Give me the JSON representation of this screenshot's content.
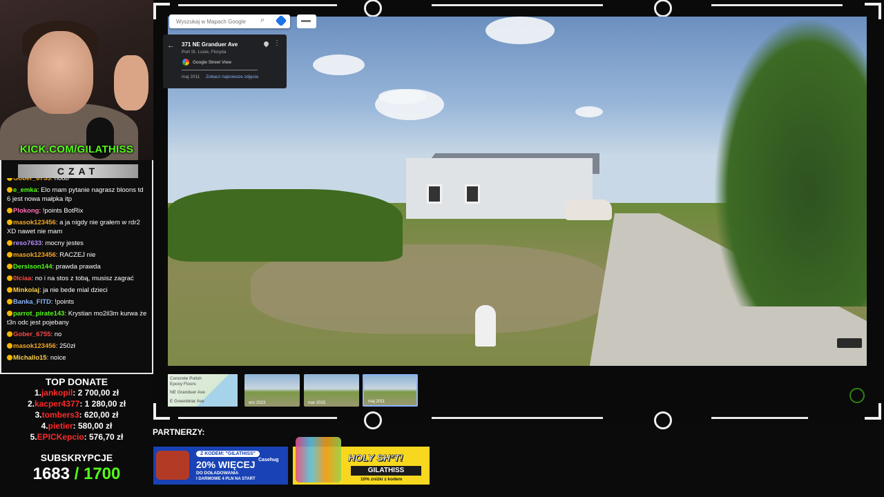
{
  "stream": {
    "kick_url": "KICK.COM/GILATHISS",
    "chat_title": "CZAT",
    "chat_messages": [
      {
        "user": "Gober_6755",
        "text": "noob",
        "color": "#f5a623"
      },
      {
        "user": "e_emka",
        "text": "Elo mam pytanie nagrasz bloons td 6 jest nowa małpka itp",
        "color": "#53fc18"
      },
      {
        "user": "Plokong",
        "text": "!points BotRix",
        "color": "#ff6fb5"
      },
      {
        "user": "masok123456",
        "text": "a ja nigdy nie grałem w rdr2 XD nawet nie mam",
        "color": "#f5a623"
      },
      {
        "user": "reso7633",
        "text": "mocny jestes",
        "color": "#b48cff"
      },
      {
        "user": "masok123456",
        "text": "RACZEJ nie",
        "color": "#f5a623"
      },
      {
        "user": "Dersison144",
        "text": "prawda prawda",
        "color": "#53fc18"
      },
      {
        "user": "0lciaa",
        "text": "no i na stos z tobą, musisz zagrać",
        "color": "#ff4646"
      },
      {
        "user": "Minkolaj",
        "text": "ja nie bede mial dzieci",
        "color": "#ffd24a"
      },
      {
        "user": "Banka_FITD",
        "text": "!points",
        "color": "#8ab4f8"
      },
      {
        "user": "parrot_pirate143",
        "text": "Krystian mo2il3m kurwa że t3n odc jest pojebany",
        "color": "#53fc18"
      },
      {
        "user": "Gober_6755",
        "text": "no",
        "color": "#ff4646"
      },
      {
        "user": "masok123456",
        "text": "250zł",
        "color": "#f5a623"
      },
      {
        "user": "Michallo15",
        "text": "noice",
        "color": "#ffd24a"
      }
    ],
    "top_donate_title": "TOP DONATE",
    "top_donate": [
      {
        "rank": "1.",
        "name": "jankopil",
        "amount": ": 2 700,00 zł"
      },
      {
        "rank": "2.",
        "name": "kacper4377",
        "amount": ": 1 280,00 zł"
      },
      {
        "rank": "3.",
        "name": "tombers3",
        "amount": ": 620,00 zł"
      },
      {
        "rank": "4.",
        "name": "pietier",
        "amount": ": 580,00 zł"
      },
      {
        "rank": "5.",
        "name": "EPICKepcio",
        "amount": ": 576,70 zł"
      }
    ],
    "subs_title": "SUBSKRYPCJE",
    "subs_current": "1683",
    "subs_goal": " / 1700",
    "partners_title": "PARTNERZY:"
  },
  "maps": {
    "search_placeholder": "Wyszukaj w Mapach Google",
    "address": "371 NE Granduer Ave",
    "city": "Port St. Lucie, Floryda",
    "brand": "Google Street View",
    "date": "maj 2011",
    "latest_link": "Zobacz najnowsze zdjęcia",
    "map_labels": [
      "Concrete Polish",
      "Epoxy Floors",
      "NE Granduer Ave",
      "E Greenbriar Ave"
    ],
    "history": [
      {
        "label": "wrz 2023"
      },
      {
        "label": "mar 2015"
      },
      {
        "label": "maj 2011",
        "active": true
      }
    ]
  },
  "banners": {
    "casehug": {
      "code": "Z KODEM: \"GILATHISS\"",
      "brand": "Casehug",
      "percent": "20% WIĘCEJ",
      "line1": "DO DOŁADOWANIA",
      "line2": "I DARMOWE 4 PLN NA START"
    },
    "holy": {
      "title": "HOLY SH*T!",
      "code": "GILATHISS",
      "sub": "10% zniżki z kodem"
    }
  },
  "colors": {
    "kick_green": "#53fc18",
    "donate_red": "#ff2a2a"
  }
}
